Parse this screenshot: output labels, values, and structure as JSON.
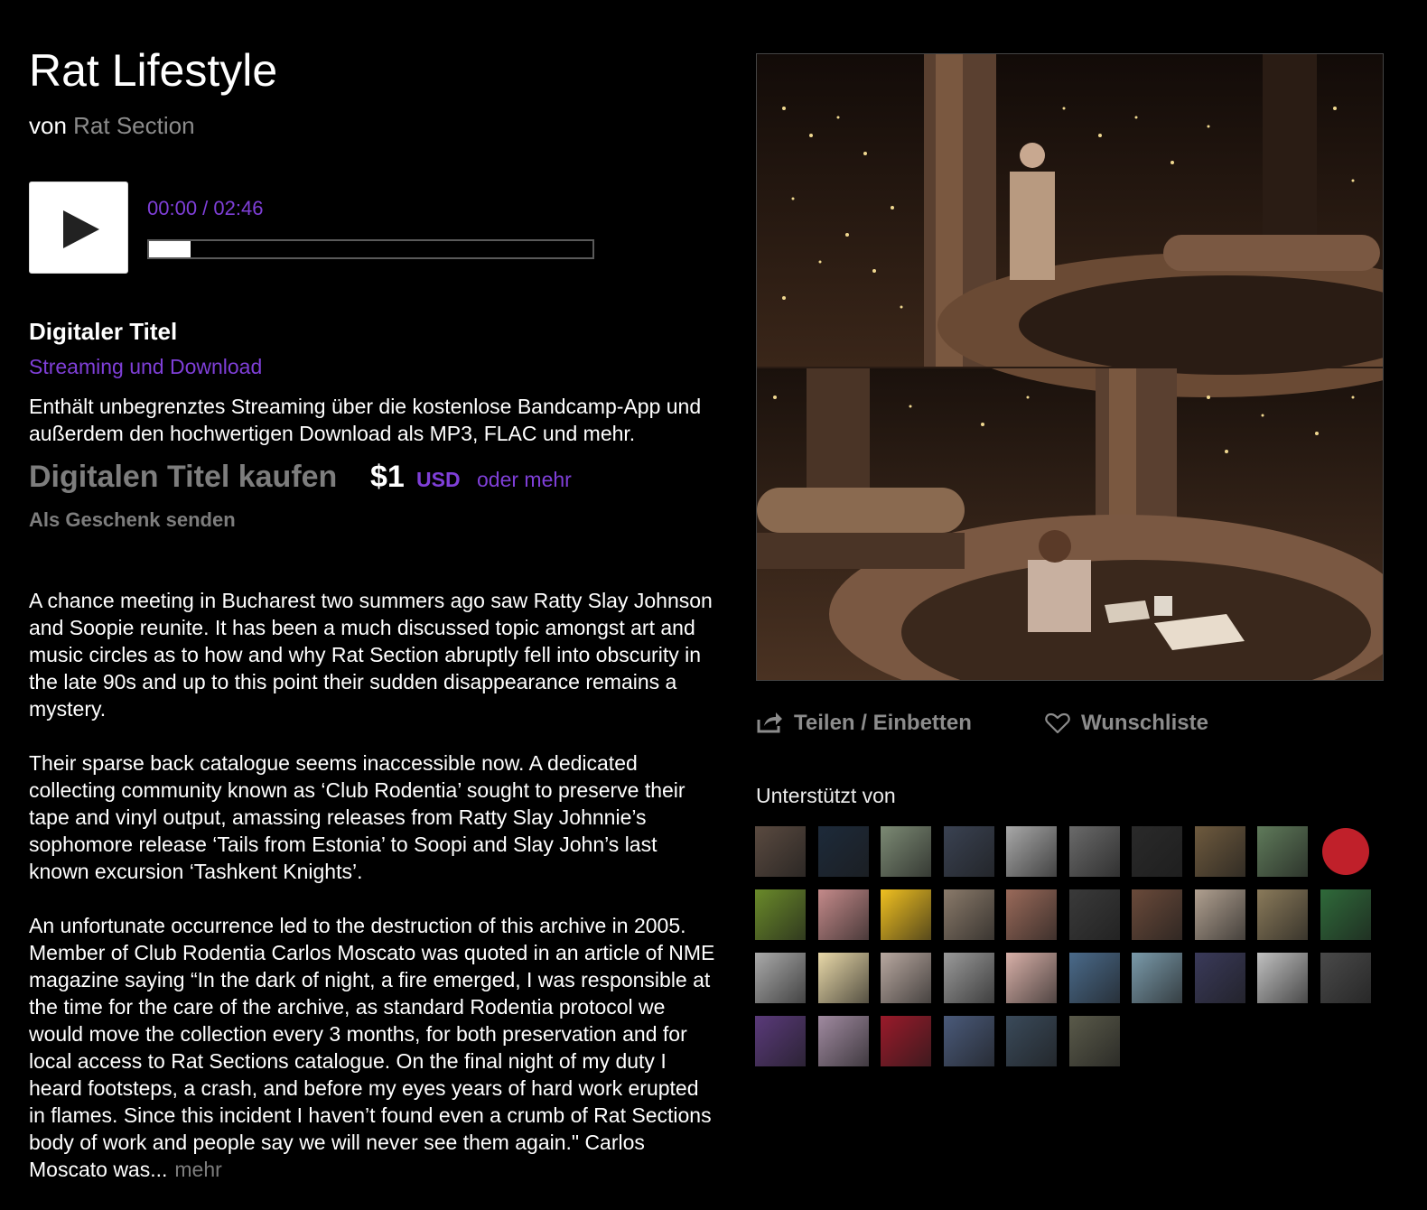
{
  "album": {
    "title": "Rat Lifestyle",
    "by_prefix": "von",
    "artist": "Rat Section"
  },
  "player": {
    "time": "00:00 / 02:46",
    "progress": 0
  },
  "purchase": {
    "heading": "Digitaler Titel",
    "subheading": "Streaming und Download",
    "description": "Enthält unbegrenztes Streaming über die kostenlose Bandcamp-App und außerdem den hochwertigen Download als MP3, FLAC und mehr.",
    "buy_label": "Digitalen Titel kaufen",
    "price": "$1",
    "currency": "USD",
    "or_more": "oder mehr",
    "gift_label": "Als Geschenk senden"
  },
  "about": {
    "paragraphs": [
      "A chance meeting in Bucharest two summers ago saw Ratty Slay Johnson and Soopie reunite. It has been a much discussed topic amongst art and music circles as to how and why Rat Section abruptly fell into obscurity in the late 90s and up to this point their sudden disappearance remains a mystery.",
      "Their sparse back catalogue seems inaccessible now. A dedicated collecting community known as ‘Club Rodentia’ sought to preserve their tape and vinyl output, amassing releases from Ratty Slay Johnnie’s sophomore release ‘Tails from Estonia’ to Soopi and Slay John’s last known excursion ‘Tashkent Knights’.",
      "An unfortunate occurrence led to the destruction of this archive in 2005. Member of Club Rodentia Carlos Moscato was quoted in an article of NME magazine saying “In the dark of night, a fire emerged, I was responsible at the time for the care of the archive, as standard Rodentia protocol we would move the collection every 3 months, for both preservation and for local access to Rat Sections catalogue. On the final night of my duty I heard footsteps, a crash, and before my eyes years of hard work erupted in flames. Since this incident I haven’t found even a crumb of Rat Sections body of work and people say we will never see them again.\" Carlos Moscato was..."
    ],
    "more_label": "mehr"
  },
  "actions": {
    "share_label": "Teilen / Einbetten",
    "share_icon": "share-icon",
    "wishlist_label": "Wunschliste",
    "wishlist_icon": "heart-icon"
  },
  "supporters": {
    "heading": "Unterstützt von",
    "count": 36,
    "avatar_colors": [
      "#5a4a40",
      "#1d2a3a",
      "#7c8a74",
      "#3a4252",
      "#a8a8a8",
      "#6a6a6a",
      "#2a2a2a",
      "#6e5a3e",
      "#5f7a5a",
      "#c0202a",
      "#6a8a2a",
      "#c48a8a",
      "#f0c020",
      "#8a7a6a",
      "#9a6a5a",
      "#3a3a3a",
      "#6a4a3a",
      "#b0a090",
      "#8a7a5a",
      "#2f6a3a",
      "#aaaaaa",
      "#e8d8a8",
      "#b8a8a0",
      "#9a9a9a",
      "#d8b0a8",
      "#4a6a8a",
      "#7a9aaa",
      "#3a3a5a",
      "#c0c0c0",
      "#4a4a4a",
      "#5a3a7a",
      "#a08aa0",
      "#9a1a2a",
      "#4a5a7a",
      "#3a4a5a",
      "#5a5a4a"
    ]
  }
}
